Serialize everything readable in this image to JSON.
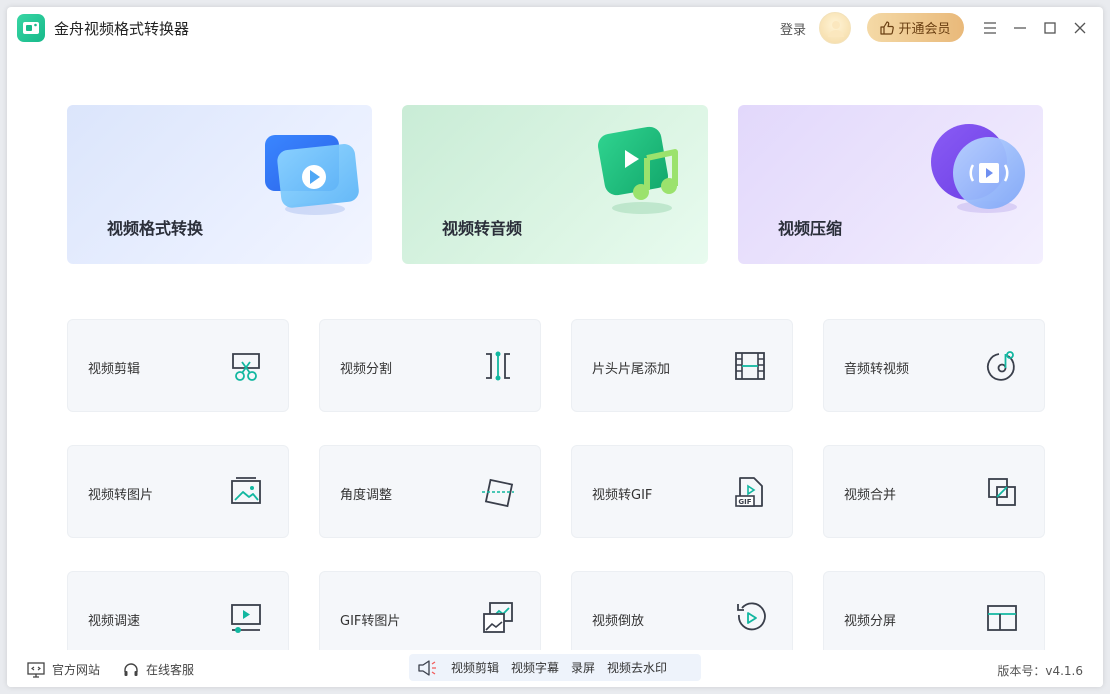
{
  "app": {
    "title": "金舟视频格式转换器"
  },
  "header": {
    "login_label": "登录",
    "vip_label": "开通会员"
  },
  "feature_cards": [
    {
      "label": "视频格式转换"
    },
    {
      "label": "视频转音频"
    },
    {
      "label": "视频压缩"
    }
  ],
  "tools": [
    {
      "label": "视频剪辑",
      "icon": "scissors-icon"
    },
    {
      "label": "视频分割",
      "icon": "split-icon"
    },
    {
      "label": "片头片尾添加",
      "icon": "film-icon"
    },
    {
      "label": "音频转视频",
      "icon": "music-disc-icon"
    },
    {
      "label": "视频转图片",
      "icon": "image-icon"
    },
    {
      "label": "角度调整",
      "icon": "rotate-frame-icon"
    },
    {
      "label": "视频转GIF",
      "icon": "gif-file-icon"
    },
    {
      "label": "视频合并",
      "icon": "merge-icon"
    },
    {
      "label": "视频调速",
      "icon": "speed-screen-icon"
    },
    {
      "label": "GIF转图片",
      "icon": "gif-image-icon"
    },
    {
      "label": "视频倒放",
      "icon": "reverse-play-icon"
    },
    {
      "label": "视频分屏",
      "icon": "split-screen-icon"
    }
  ],
  "footer": {
    "website_label": "官方网站",
    "service_label": "在线客服",
    "quick_links": [
      "视频剪辑",
      "视频字幕",
      "录屏",
      "视频去水印"
    ],
    "version": "版本号：v4.1.6"
  },
  "colors": {
    "accent": "#12b7a0",
    "icon_stroke": "#3a3f4b",
    "vip_gold": "#e9b97a"
  }
}
